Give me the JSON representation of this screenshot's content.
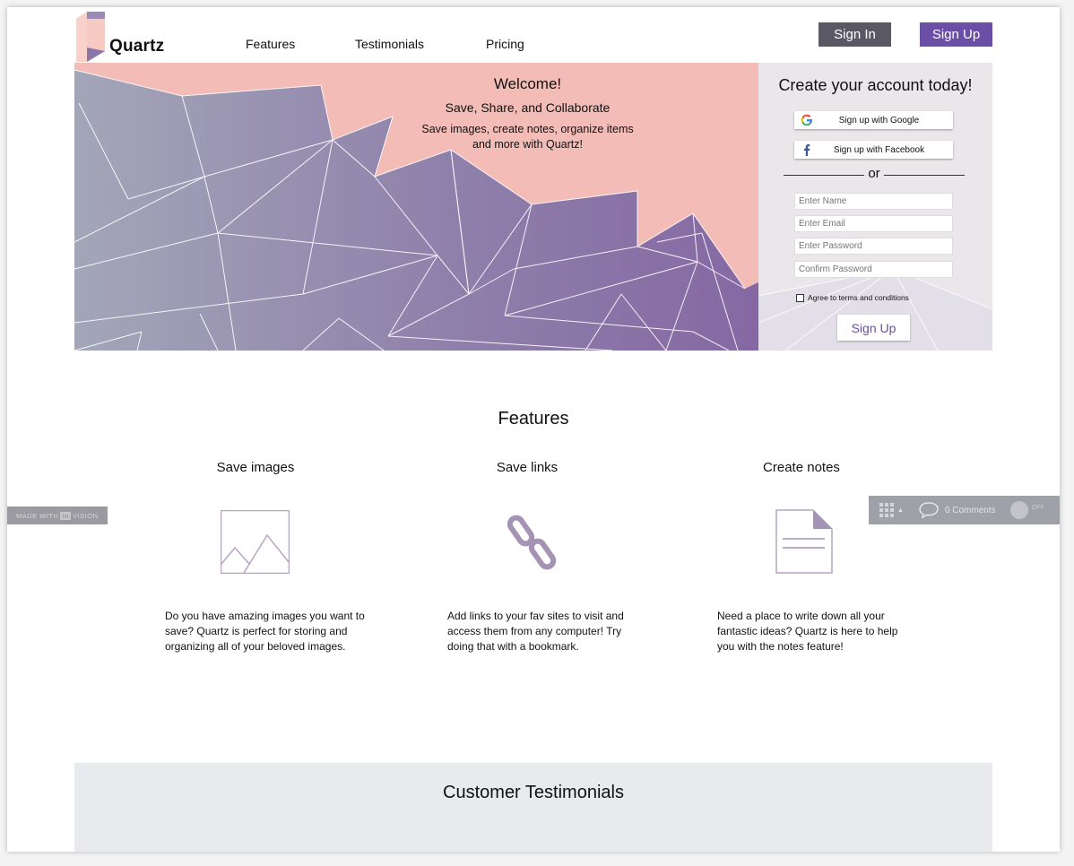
{
  "brand": {
    "name": "Quartz"
  },
  "nav": {
    "features": "Features",
    "testimonials": "Testimonials",
    "pricing": "Pricing",
    "sign_in": "Sign In",
    "sign_up": "Sign Up"
  },
  "hero": {
    "welcome": "Welcome!",
    "tagline": "Save, Share, and Collaborate",
    "description_line1": "Save images, create notes, organize items",
    "description_line2": "and more with Quartz!"
  },
  "signup_panel": {
    "title": "Create your account today!",
    "google_label": "Sign up with Google",
    "facebook_label": "Sign up with Facebook",
    "or": "or",
    "name_placeholder": "Enter Name",
    "email_placeholder": "Enter Email",
    "password_placeholder": "Enter Password",
    "confirm_placeholder": "Confirm Password",
    "agree_label": "Agree to terms and conditions",
    "submit_label": "Sign Up"
  },
  "features": {
    "title": "Features",
    "items": [
      {
        "title": "Save images",
        "icon": "image-icon",
        "desc_lines": [
          "Do you have amazing images you want to",
          "save? Quartz is perfect for storing and",
          "organizing all of your beloved images."
        ]
      },
      {
        "title": "Save links",
        "icon": "link-icon",
        "desc_lines": [
          "Add links to your fav sites to visit and",
          "access them from any computer! Try",
          "doing that with a bookmark."
        ]
      },
      {
        "title": "Create notes",
        "icon": "note-icon",
        "desc_lines": [
          "Need a place to write down all your",
          "fantastic ideas? Quartz is here to help",
          "you with the notes feature!"
        ]
      }
    ]
  },
  "testimonials": {
    "title": "Customer Testimonials"
  },
  "invision": {
    "made_with": "MADE WITH",
    "brand_in": "in",
    "brand_rest": "VISION"
  },
  "toolbar": {
    "comments": "0 Comments",
    "toggle": "OFF"
  },
  "colors": {
    "accent": "#6b4ea6",
    "signin": "#5b5866",
    "hero_pink": "#f4bcb6",
    "panel_bg": "#ebe6e9"
  }
}
